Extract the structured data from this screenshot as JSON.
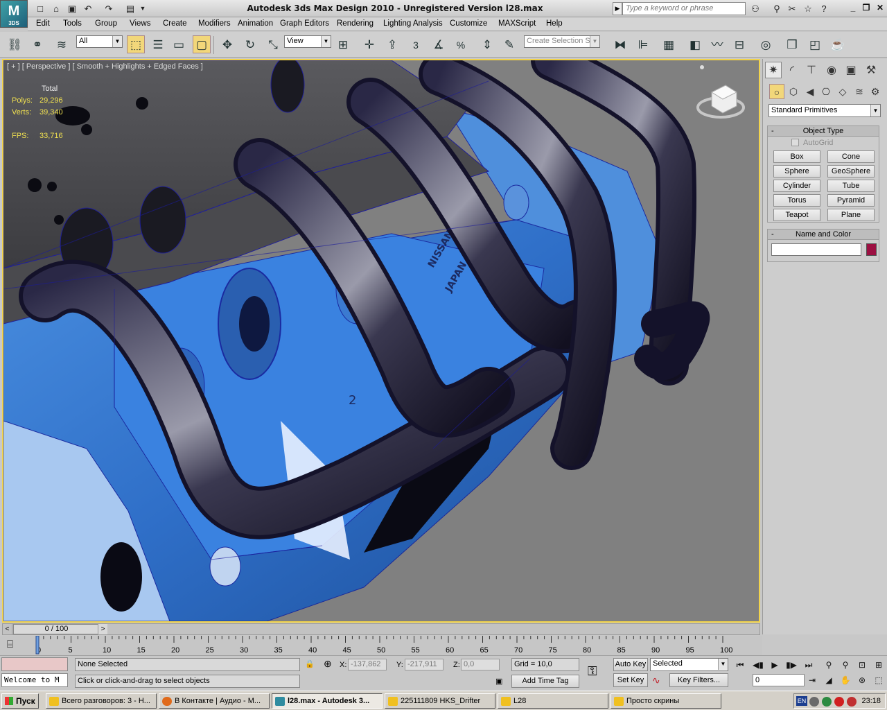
{
  "titlebar": {
    "logo": "M",
    "logo_sub": "3DS",
    "title": "Autodesk 3ds Max Design 2010    -  Unregistered Version      l28.max",
    "search_placeholder": "Type a keyword or phrase"
  },
  "menu": [
    "Edit",
    "Tools",
    "Group",
    "Views",
    "Create",
    "Modifiers",
    "Animation",
    "Graph Editors",
    "Rendering",
    "Lighting Analysis",
    "Customize",
    "MAXScript",
    "Help"
  ],
  "toolbar": {
    "selection_filter": "All",
    "reference_coord": "View",
    "named_selection_placeholder": "Create Selection Se",
    "snap_3": "3",
    "snap_percent": "%"
  },
  "viewport": {
    "label_plus": "[ + ]",
    "label_view": "[ Perspective ]",
    "label_shading": "[ Smooth + Highlights + Edged Faces ]",
    "stats_header": "Total",
    "polys_label": "Polys:",
    "polys_value": "29,296",
    "verts_label": "Verts:",
    "verts_value": "39,340",
    "fps_label": "FPS:",
    "fps_value": "33,716",
    "decal_line1": "NISSAN",
    "decal_line2": "JAPAN",
    "cylinder_number": "2"
  },
  "command_panel": {
    "primitive_type": "Standard Primitives",
    "object_type_title": "Object Type",
    "autogrid_label": "AutoGrid",
    "primitives": [
      "Box",
      "Cone",
      "Sphere",
      "GeoSphere",
      "Cylinder",
      "Tube",
      "Torus",
      "Pyramid",
      "Teapot",
      "Plane"
    ],
    "name_color_title": "Name and Color",
    "name_value": "",
    "color": "#9c1042"
  },
  "time": {
    "slider_label": "0 / 100",
    "ticks": [
      "0",
      "5",
      "10",
      "15",
      "20",
      "25",
      "30",
      "35",
      "40",
      "45",
      "50",
      "55",
      "60",
      "65",
      "70",
      "75",
      "80",
      "85",
      "90",
      "95",
      "100"
    ]
  },
  "status": {
    "maxscript_text": "Welcome to M",
    "selection_status": "None Selected",
    "prompt": "Click or click-and-drag to select objects",
    "x_label": "X:",
    "x_value": "-137,862",
    "y_label": "Y:",
    "y_value": "-217,911",
    "z_label": "Z:",
    "z_value": "0,0",
    "grid": "Grid = 10,0",
    "add_time_tag": "Add Time Tag",
    "auto_key": "Auto Key",
    "set_key": "Set Key",
    "key_mode": "Selected",
    "key_filters": "Key Filters...",
    "current_frame": "0"
  },
  "taskbar": {
    "start": "Пуск",
    "tasks": [
      {
        "label": "Всего разговоров: 3 - Н...",
        "color": "#f0c020"
      },
      {
        "label": "В Контакте | Аудио - М...",
        "color": "#e06a1a"
      },
      {
        "label": "l28.max - Autodesk 3...",
        "color": "#2f8ca0"
      },
      {
        "label": "225111809 HKS_Drifter",
        "color": "#f0c020"
      },
      {
        "label": "L28",
        "color": "#f0c020"
      },
      {
        "label": "Просто скрины",
        "color": "#f0c020"
      }
    ],
    "lang": "EN",
    "clock": "23:18"
  }
}
